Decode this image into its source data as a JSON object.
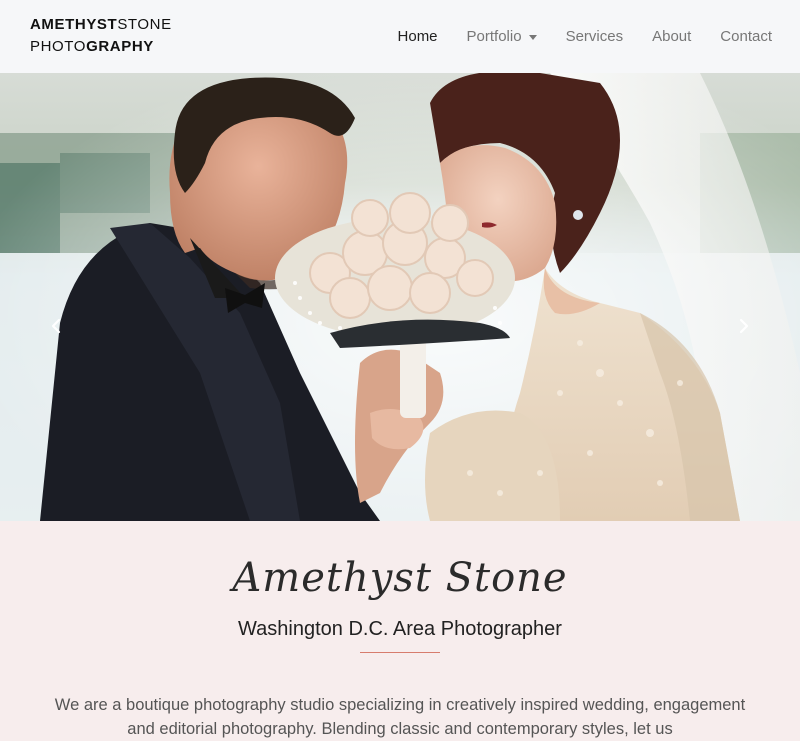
{
  "brand": {
    "line1_bold": "AMETHYST",
    "line1_rest": "STONE",
    "line2_rest": "PHOTO",
    "line2_bold": "GRAPHY"
  },
  "nav": {
    "items": [
      {
        "label": "Home",
        "active": true
      },
      {
        "label": "Portfolio",
        "dropdown": true
      },
      {
        "label": "Services"
      },
      {
        "label": "About"
      },
      {
        "label": "Contact"
      }
    ]
  },
  "carousel": {
    "prev_icon": "chevron-left-icon",
    "next_icon": "chevron-right-icon"
  },
  "intro": {
    "script_title": "Amethyst Stone",
    "subtitle": "Washington D.C. Area Photographer",
    "body": "We are a boutique photography studio specializing in creatively inspired wedding, engagement and editorial photography. Blending classic and contemporary styles, let us"
  },
  "colors": {
    "navbar_bg": "#f6f7f9",
    "section_bg": "#f7eded",
    "divider": "#d77c6d"
  }
}
